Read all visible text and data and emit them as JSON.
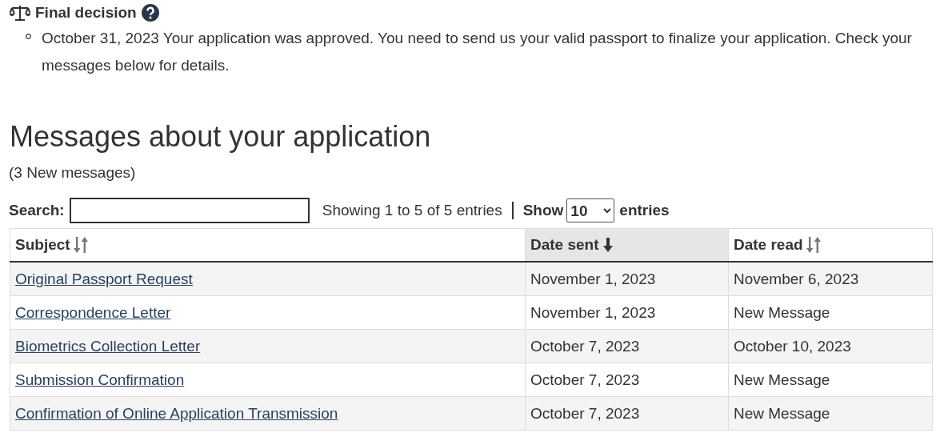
{
  "final_decision": {
    "title": "Final decision",
    "items": [
      "October 31, 2023 Your application was approved. You need to send us your valid passport to finalize your application. Check your messages below for details."
    ]
  },
  "messages": {
    "heading": "Messages about your application",
    "new_count": "(3 New messages)",
    "search": {
      "label": "Search:"
    },
    "info": "Showing 1 to 5 of 5 entries",
    "show": {
      "label": "Show",
      "value": "10",
      "suffix": "entries"
    },
    "columns": [
      {
        "label": "Subject",
        "selected": false
      },
      {
        "label": "Date sent",
        "selected": true
      },
      {
        "label": "Date read",
        "selected": false
      }
    ],
    "rows": [
      {
        "subject": "Original Passport Request",
        "date_sent": "November 1, 2023",
        "date_read": "November 6, 2023"
      },
      {
        "subject": "Correspondence Letter",
        "date_sent": "November 1, 2023",
        "date_read": "New Message"
      },
      {
        "subject": "Biometrics Collection Letter",
        "date_sent": "October 7, 2023",
        "date_read": "October 10, 2023"
      },
      {
        "subject": "Submission Confirmation",
        "date_sent": "October 7, 2023",
        "date_read": "New Message"
      },
      {
        "subject": "Confirmation of Online Application Transmission",
        "date_sent": "October 7, 2023",
        "date_read": "New Message"
      }
    ]
  }
}
